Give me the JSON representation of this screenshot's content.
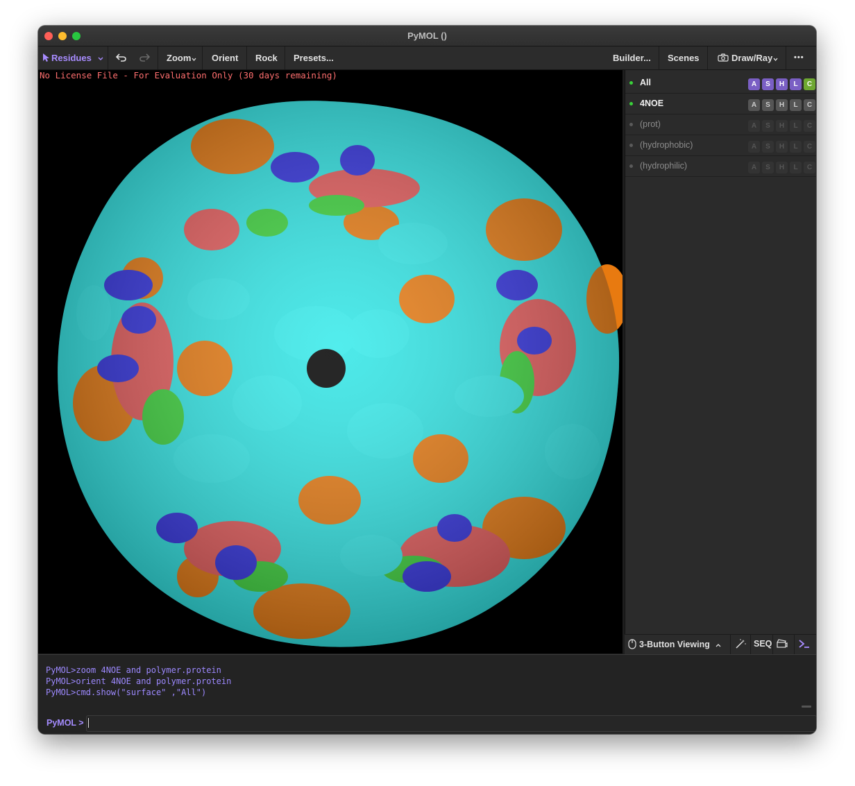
{
  "window": {
    "title": "PyMOL ()"
  },
  "toolbar": {
    "mode_label": "Residues",
    "zoom_label": "Zoom",
    "orient_label": "Orient",
    "rock_label": "Rock",
    "presets_label": "Presets...",
    "builder_label": "Builder...",
    "scenes_label": "Scenes",
    "drawray_label": "Draw/Ray",
    "more_label": "•••"
  },
  "viewport": {
    "license_text": "No License File - For Evaluation Only (30 days remaining)"
  },
  "objects": [
    {
      "name": "All",
      "enabled": true,
      "buttons": [
        "A",
        "S",
        "H",
        "L",
        "C"
      ]
    },
    {
      "name": "4NOE",
      "enabled": true,
      "buttons": [
        "A",
        "S",
        "H",
        "L",
        "C"
      ]
    },
    {
      "name": "(prot)",
      "enabled": false,
      "buttons": [
        "A",
        "S",
        "H",
        "L",
        "C"
      ]
    },
    {
      "name": "(hydrophobic)",
      "enabled": false,
      "buttons": [
        "A",
        "S",
        "H",
        "L",
        "C"
      ]
    },
    {
      "name": "(hydrophilic)",
      "enabled": false,
      "buttons": [
        "A",
        "S",
        "H",
        "L",
        "C"
      ]
    }
  ],
  "panel_bottom": {
    "viewing_label": "3-Button Viewing",
    "seq_label": "SEQ"
  },
  "console": {
    "lines": [
      "PyMOL>zoom 4NOE and polymer.protein",
      "PyMOL>orient 4NOE and polymer.protein",
      "PyMOL>cmd.show(\"surface\"   ,\"All\")"
    ],
    "prompt_label": "PyMOL >",
    "input_value": ""
  },
  "colors": {
    "accent": "#a88cff",
    "cyan": "#2ee6e6",
    "orange": "#e87a10",
    "green": "#3ad23a",
    "salmon": "#e65a5a",
    "blue": "#3030e0"
  }
}
